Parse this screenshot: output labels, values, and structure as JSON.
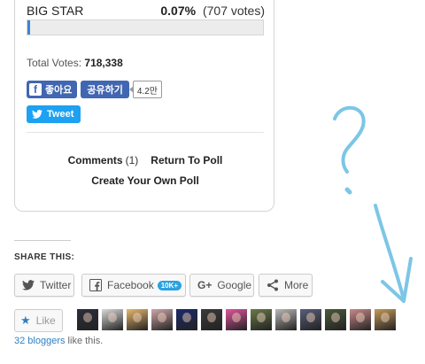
{
  "poll": {
    "option_name": "BIG STAR",
    "option_pct": "0.07%",
    "option_votes": "(707 votes)",
    "option_fraction": 0.0007,
    "total_label": "Total Votes:",
    "total_value": "718,338",
    "fb_like_label": "좋아요",
    "fb_share_label": "공유하기",
    "fb_share_count": "4.2만",
    "tweet_label": "Tweet",
    "comments_label": "Comments",
    "comments_count": "(1)",
    "return_label": "Return To Poll",
    "create_label": "Create Your Own Poll"
  },
  "share": {
    "title": "SHARE THIS:",
    "twitter_label": "Twitter",
    "facebook_label": "Facebook",
    "facebook_count": "10K+",
    "google_label": "Google",
    "more_label": "More"
  },
  "likes": {
    "like_label": "Like",
    "bloggers_count": "32 bloggers",
    "bloggers_suffix": " like this.",
    "avatars": [
      {
        "bg": "#2a2f3a"
      },
      {
        "bg": "#d9d9d9"
      },
      {
        "bg": "#e8b86c"
      },
      {
        "bg": "#cfa6a8"
      },
      {
        "bg": "#1b2a6b"
      },
      {
        "bg": "#3b3b3b"
      },
      {
        "bg": "#e0559e"
      },
      {
        "bg": "#6a7a4a"
      },
      {
        "bg": "#b8b8b8"
      },
      {
        "bg": "#5a5e7a"
      },
      {
        "bg": "#4a5a3a"
      },
      {
        "bg": "#c98a8a"
      },
      {
        "bg": "#c49a5a"
      }
    ]
  },
  "colors": {
    "bar_fill": "#3a86d6",
    "facebook_blue": "#4267b2",
    "twitter_blue": "#1da1f2",
    "doodle_blue": "#7cc6e6"
  }
}
